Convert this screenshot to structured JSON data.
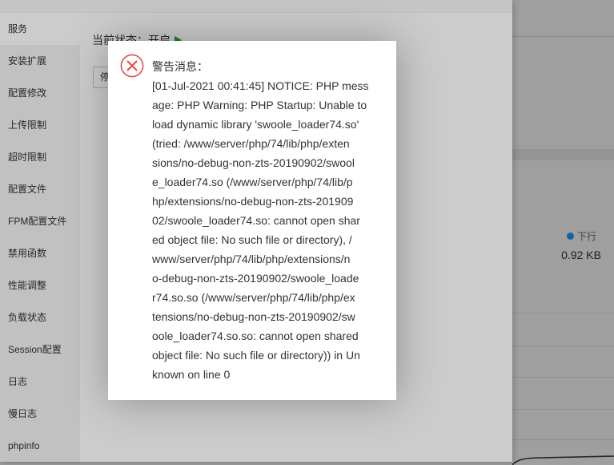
{
  "php_window": {
    "sidebar": {
      "items": [
        {
          "label": "服务",
          "active": true
        },
        {
          "label": "安装扩展"
        },
        {
          "label": "配置修改"
        },
        {
          "label": "上传限制"
        },
        {
          "label": "超时限制"
        },
        {
          "label": "配置文件"
        },
        {
          "label": "FPM配置文件"
        },
        {
          "label": "禁用函数"
        },
        {
          "label": "性能调整"
        },
        {
          "label": "负载状态"
        },
        {
          "label": "Session配置"
        },
        {
          "label": "日志"
        },
        {
          "label": "慢日志"
        },
        {
          "label": "phpinfo"
        }
      ]
    },
    "service": {
      "status_text": "当前状态：开启",
      "status_icon": "play-icon",
      "status_icon_color": "#20a53a",
      "stop_button_label": "停"
    }
  },
  "background_page": {
    "traffic": {
      "legend_icon": "dot-icon",
      "legend_icon_color": "#20a0ff",
      "label": "下行",
      "value": "0.92 KB"
    }
  },
  "dialog": {
    "icon": "error-circle-icon",
    "icon_color": "#e64a4f",
    "title": "警告消息：",
    "message_lines": [
      "[01-Jul-2021 00:41:45] NOTICE: PHP mess",
      "age: PHP Warning: PHP Startup: Unable to",
      "load dynamic library 'swoole_loader74.so'",
      "(tried: /www/server/php/74/lib/php/exten",
      "sions/no-debug-non-zts-20190902/swool",
      "e_loader74.so (/www/server/php/74/lib/p",
      "hp/extensions/no-debug-non-zts-201909",
      "02/swoole_loader74.so: cannot open shar",
      "ed object file: No such file or directory), /",
      "www/server/php/74/lib/php/extensions/n",
      "o-debug-non-zts-20190902/swoole_loade",
      "r74.so.so (/www/server/php/74/lib/php/ex",
      "tensions/no-debug-non-zts-20190902/sw",
      "oole_loader74.so.so: cannot open shared",
      "object file: No such file or directory)) in Un",
      "known on line 0"
    ]
  }
}
